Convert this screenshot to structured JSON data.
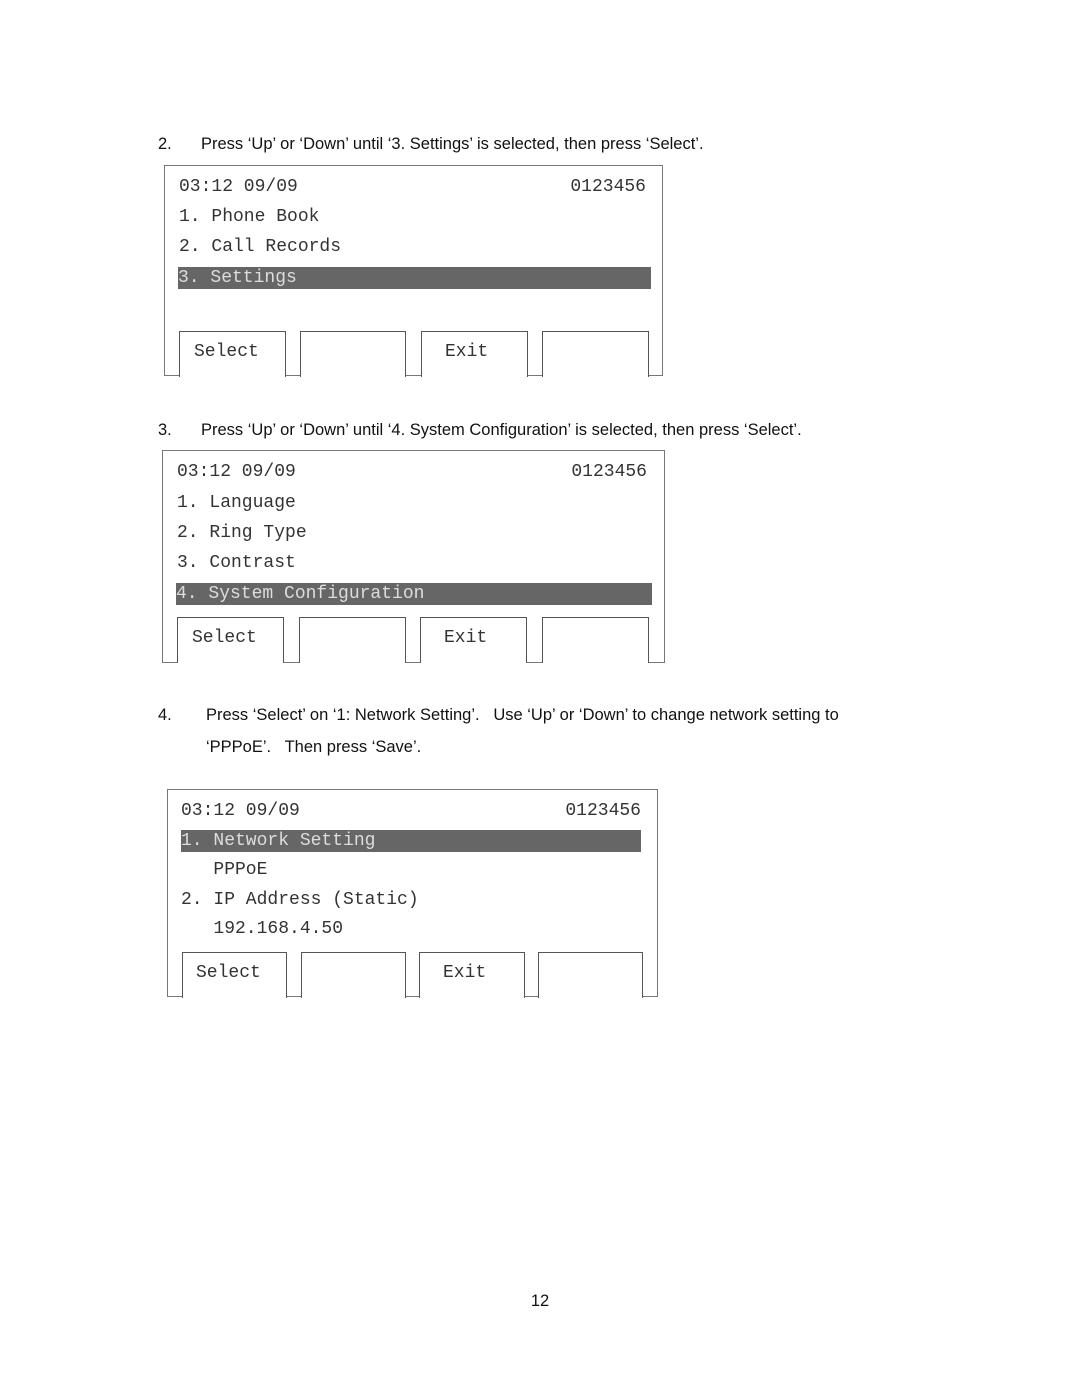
{
  "steps": [
    {
      "number": "2.",
      "text": "Press ‘Up’ or ‘Down’ until ‘3. Settings’ is selected, then press ‘Select’."
    },
    {
      "number": "3.",
      "text": "Press ‘Up’ or ‘Down’ until ‘4. System Configuration’ is selected, then press ‘Select’."
    },
    {
      "number": "4.",
      "text": "Press ‘Select’ on ‘1: Network Setting’.   Use ‘Up’ or ‘Down’ to change network setting to",
      "text2": "‘PPPoE’.   Then press ‘Save’."
    }
  ],
  "screens": [
    {
      "time_date": "03:12 09/09",
      "number": "0123456",
      "rows": [
        "1. Phone Book",
        "2. Call Records",
        "3. Settings"
      ],
      "selected": "3. Settings",
      "softkeys": [
        "Select",
        "",
        "Exit",
        ""
      ]
    },
    {
      "time_date": "03:12 09/09",
      "number": "0123456",
      "rows": [
        "1. Language",
        "2. Ring Type",
        "3. Contrast",
        "4. System Configuration"
      ],
      "selected": "4. System Configuration",
      "softkeys": [
        "Select",
        "",
        "Exit",
        ""
      ]
    },
    {
      "time_date": "03:12 09/09",
      "number": "0123456",
      "rows": [
        "1. Network Setting",
        "   PPPoE",
        "2. IP Address (Static)",
        "   192.168.4.50"
      ],
      "selected": "1. Network Setting",
      "softkeys": [
        "Select",
        "",
        "Exit",
        ""
      ]
    }
  ],
  "colors": {
    "highlight_bg": "#666666",
    "highlight_fg": "#dddddd"
  },
  "page_number": "12"
}
